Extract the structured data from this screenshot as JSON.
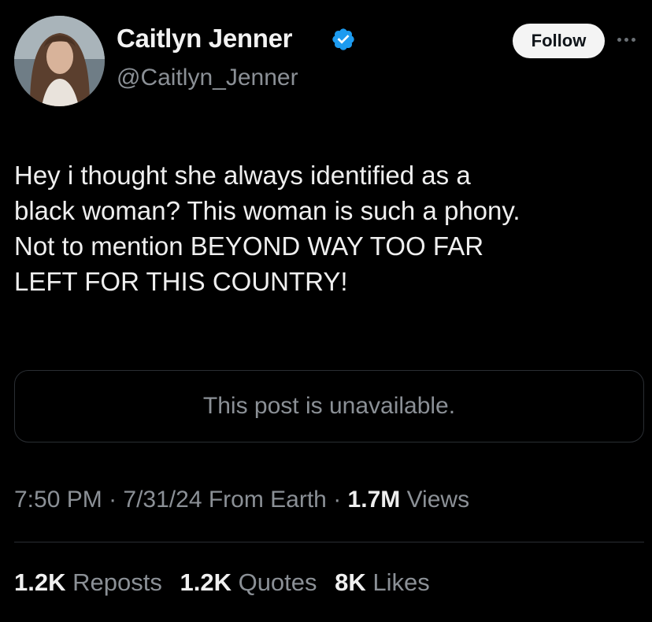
{
  "author": {
    "display_name": "Caitlyn Jenner",
    "handle": "@Caitlyn_Jenner",
    "verified": true,
    "verified_color": "#1d9bf0"
  },
  "actions": {
    "follow_label": "Follow",
    "more_icon": "more-horizontal-icon"
  },
  "tweet": {
    "lines": [
      "Hey i thought she always identified as a",
      "black woman? This woman is such a phony.",
      "Not to mention BEYOND WAY TOO FAR",
      "LEFT FOR THIS COUNTRY!"
    ]
  },
  "quoted_post": {
    "text": "This post is unavailable."
  },
  "meta": {
    "time": "7:50 PM",
    "sep1": " · ",
    "date": "7/31/24",
    "source": " From Earth",
    "sep2": " · ",
    "views_count": "1.7M",
    "views_label": " Views"
  },
  "stats": {
    "reposts_count": "1.2K",
    "reposts_label": "Reposts",
    "quotes_count": "1.2K",
    "quotes_label": "Quotes",
    "likes_count": "8K",
    "likes_label": "Likes"
  }
}
